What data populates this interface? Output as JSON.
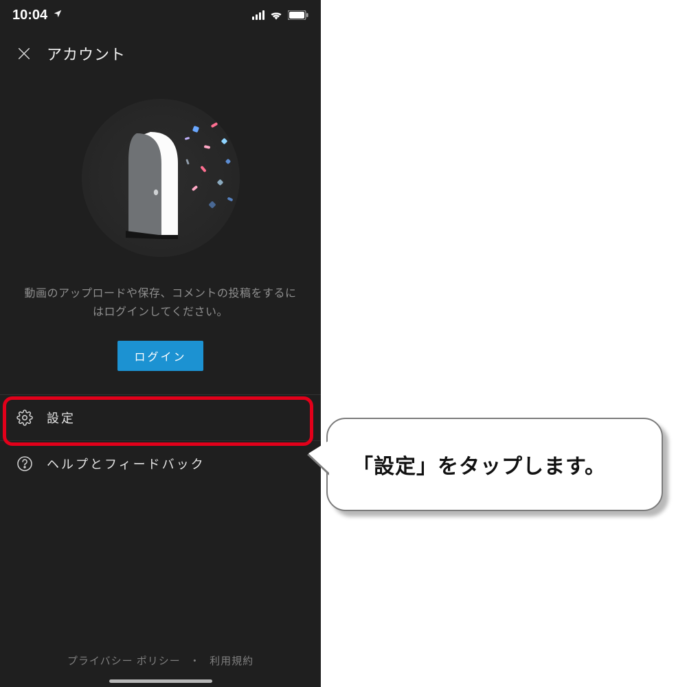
{
  "statusbar": {
    "time": "10:04"
  },
  "header": {
    "title": "アカウント"
  },
  "body": {
    "message": "動画のアップロードや保存、コメントの投稿をするにはログインしてください。",
    "login_label": "ログイン"
  },
  "menu": {
    "items": [
      {
        "icon": "gear-icon",
        "label": "設定"
      },
      {
        "icon": "help-icon",
        "label": "ヘルプとフィードバック"
      }
    ]
  },
  "footer": {
    "privacy": "プライバシー ポリシー",
    "separator": "・",
    "terms": "利用規約"
  },
  "callout": {
    "text": "「設定」をタップします。"
  },
  "colors": {
    "highlight": "#e2001a",
    "primary_button": "#1c92d2",
    "screen_bg": "#1f1f1f"
  }
}
